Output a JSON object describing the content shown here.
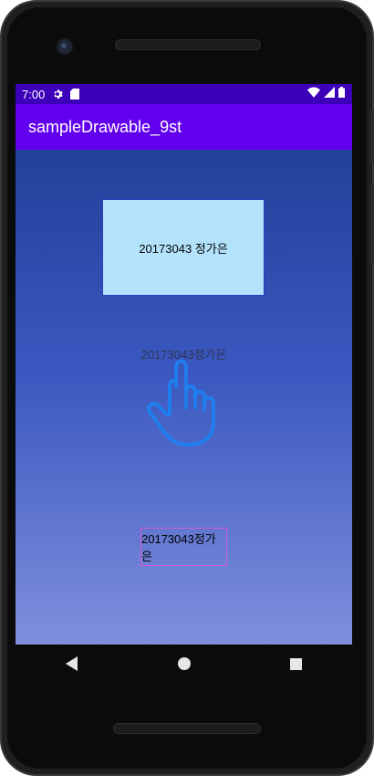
{
  "status_bar": {
    "time": "7:00",
    "left_icons": [
      "gear-icon",
      "sd-card-icon"
    ],
    "right_icons": [
      "wifi-icon",
      "signal-icon",
      "battery-icon"
    ],
    "color": "#3c00b8"
  },
  "app_bar": {
    "title": "sampleDrawable_9st",
    "color": "#6200ee"
  },
  "content": {
    "box1_text": "20173043 정가은",
    "plain_text": "20173043정가은",
    "box3_text": "20173043정가은",
    "box1_color": "#b3e3fb",
    "box3_border_color": "#d65ad8",
    "pointer_icon": "hand-pointer-icon"
  },
  "nav_bar": {
    "buttons": [
      "back-icon",
      "home-icon",
      "recents-icon"
    ]
  }
}
